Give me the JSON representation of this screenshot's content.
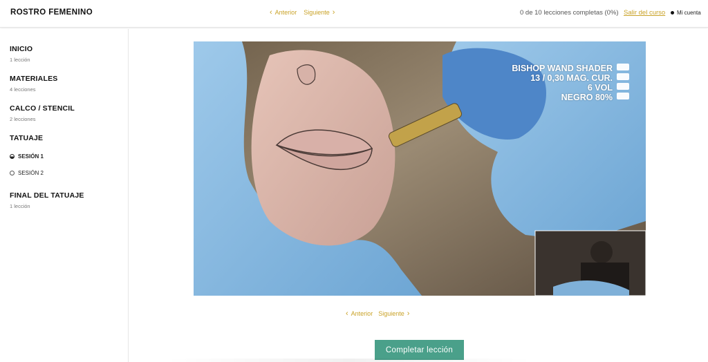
{
  "header": {
    "course_title": "ROSTRO FEMENINO",
    "prev_label": "Anterior",
    "next_label": "Siguiente",
    "progress_text": "0 de 10 lecciones completas (0%)",
    "exit_label": "Salir del curso",
    "account_label": "Mi cuenta"
  },
  "sidebar": {
    "sections": [
      {
        "title": "INICIO",
        "subtitle": "1 lección"
      },
      {
        "title": "MATERIALES",
        "subtitle": "4 lecciones"
      },
      {
        "title": "CALCO / STENCIL",
        "subtitle": "2 lecciones"
      },
      {
        "title": "TATUAJE",
        "subtitle": ""
      },
      {
        "title": "FINAL DEL TATUAJE",
        "subtitle": "1 lección"
      }
    ],
    "lessons": [
      {
        "label": "SESIÓN 1",
        "state": "current"
      },
      {
        "label": "SESIÓN 2",
        "state": "not-started"
      }
    ]
  },
  "video": {
    "overlay_lines": [
      "BISHOP WAND SHADER",
      "13 / 0,30 MAG. CUR.",
      "6 VOL",
      "NEGRO  80%"
    ]
  },
  "footer_nav": {
    "prev_label": "Anterior",
    "next_label": "Siguiente"
  },
  "complete_button_label": "Completar lección",
  "colors": {
    "accent": "#c9a227",
    "complete_button": "#4aa08a"
  }
}
